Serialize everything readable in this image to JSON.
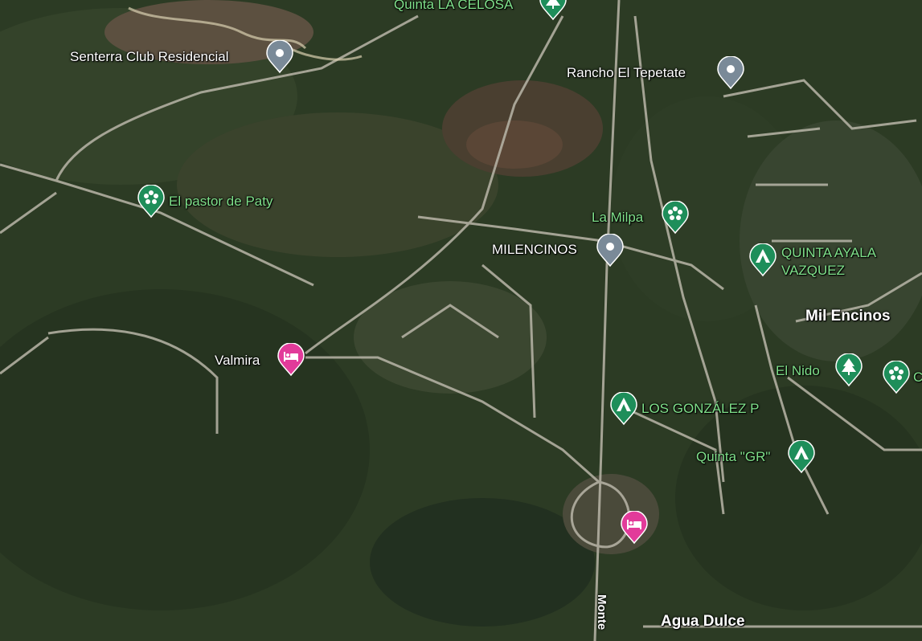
{
  "places": [
    {
      "id": "quinta-la-celosa",
      "label": "Quinta LA CELOSA",
      "type": "tree",
      "color": "#1e8e5a",
      "label_style": "green"
    },
    {
      "id": "senterra",
      "label": "Senterra Club Residencial",
      "type": "place",
      "color": "#7a8a98",
      "label_style": "white"
    },
    {
      "id": "rancho-tepetate",
      "label": "Rancho El Tepetate",
      "type": "place",
      "color": "#7a8a98",
      "label_style": "white"
    },
    {
      "id": "el-pastor",
      "label": "El pastor de Paty",
      "type": "flower",
      "color": "#1e8e5a",
      "label_style": "green"
    },
    {
      "id": "la-milpa",
      "label": "La Milpa",
      "type": "flower",
      "color": "#1e8e5a",
      "label_style": "green"
    },
    {
      "id": "milencinos",
      "label": "MILENCINOS",
      "type": "place",
      "color": "#7a8a98",
      "label_style": "white"
    },
    {
      "id": "quinta-ayala",
      "label": "QUINTA AYALA\nVAZQUEZ",
      "type": "camp",
      "color": "#1e8e5a",
      "label_style": "green"
    },
    {
      "id": "mil-encinos",
      "label": "Mil Encinos",
      "type": "none",
      "label_style": "bold"
    },
    {
      "id": "el-nido",
      "label": "El Nido",
      "type": "tree",
      "color": "#1e8e5a",
      "label_style": "green"
    },
    {
      "id": "flower-right",
      "label": "C",
      "type": "flower",
      "color": "#1e8e5a",
      "label_style": "green"
    },
    {
      "id": "valmira",
      "label": "Valmira",
      "type": "hotel",
      "color": "#e23b9a",
      "label_style": "white"
    },
    {
      "id": "los-gonzalez",
      "label": "LOS GONZÁLEZ P",
      "type": "camp",
      "color": "#1e8e5a",
      "label_style": "green"
    },
    {
      "id": "quinta-gr",
      "label": "Quinta \"GR\"",
      "type": "camp",
      "color": "#1e8e5a",
      "label_style": "green"
    },
    {
      "id": "hotel-south",
      "label": "",
      "type": "hotel",
      "color": "#e23b9a",
      "label_style": "white"
    },
    {
      "id": "agua-dulce",
      "label": "Agua Dulce",
      "type": "none",
      "label_style": "bold"
    }
  ],
  "road_label": "Monte",
  "icons": {
    "place": "place-pin-icon",
    "tree": "tree-icon",
    "flower": "flower-icon",
    "camp": "campground-icon",
    "hotel": "hotel-bed-icon"
  }
}
